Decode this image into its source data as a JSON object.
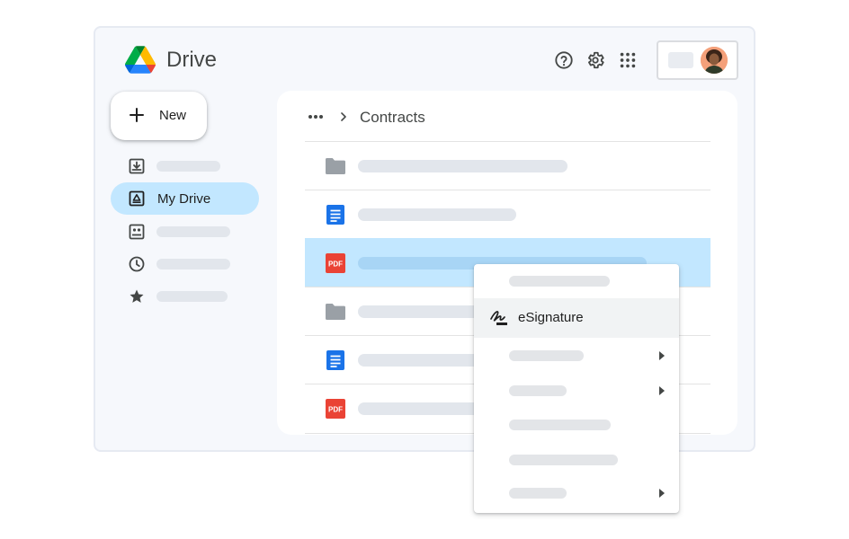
{
  "header": {
    "app_title": "Drive",
    "icons": [
      "help-icon",
      "settings-icon",
      "apps-grid-icon"
    ]
  },
  "new_button": {
    "label": "New"
  },
  "sidebar": {
    "items": [
      {
        "icon": "download-tray-icon",
        "label": "",
        "active": false
      },
      {
        "icon": "my-drive-icon",
        "label": "My Drive",
        "active": true
      },
      {
        "icon": "shared-contacts-icon",
        "label": "",
        "active": false
      },
      {
        "icon": "clock-icon",
        "label": "",
        "active": false
      },
      {
        "icon": "star-icon",
        "label": "",
        "active": false
      }
    ]
  },
  "breadcrumb": {
    "current": "Contracts"
  },
  "files": [
    {
      "icon": "folder-icon",
      "selected": false
    },
    {
      "icon": "docs-icon",
      "selected": false
    },
    {
      "icon": "pdf-icon",
      "selected": true
    },
    {
      "icon": "folder-icon",
      "selected": false
    },
    {
      "icon": "docs-icon",
      "selected": false
    },
    {
      "icon": "pdf-icon",
      "selected": false
    }
  ],
  "pdf_badge_text": "PDF",
  "context_menu": {
    "esignature_label": "eSignature"
  },
  "colors": {
    "accent_selected": "#c2e7ff",
    "docs_blue": "#1a73e8",
    "pdf_red": "#ea4335",
    "folder_gray": "#9aa0a6"
  }
}
